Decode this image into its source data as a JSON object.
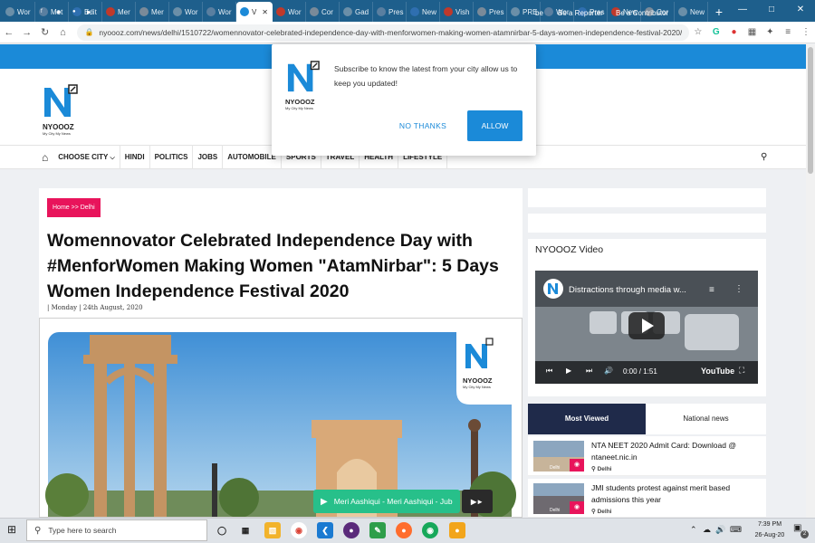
{
  "browser": {
    "tabs": [
      {
        "label": "Wor"
      },
      {
        "label": "Met"
      },
      {
        "label": "Edit"
      },
      {
        "label": "Mer"
      },
      {
        "label": "Mer"
      },
      {
        "label": "Wor"
      },
      {
        "label": "Wor"
      },
      {
        "label": "V",
        "active": true
      },
      {
        "label": "Wor"
      },
      {
        "label": "Cor"
      },
      {
        "label": "Gad"
      },
      {
        "label": "Pres"
      },
      {
        "label": "New"
      },
      {
        "label": "Vish"
      },
      {
        "label": "Pres"
      },
      {
        "label": "PRE"
      },
      {
        "label": "Wor"
      },
      {
        "label": "Pres"
      },
      {
        "label": "New"
      },
      {
        "label": "Cor"
      },
      {
        "label": "New"
      }
    ],
    "url": "nyoooz.com/news/delhi/1510722/womennovator-celebrated-independence-day-with-menforwomen-making-women-atamnirbar-5-days-women-independence-festival-2020/"
  },
  "site": {
    "top_links": [
      "Be a Reporter",
      "Be a Contributor"
    ],
    "top_link_partial": "be",
    "logo_text": "NYOOOZ",
    "logo_tagline": "My City My News",
    "nav": [
      "Choose City",
      "Hindi",
      "Politics",
      "Jobs",
      "Automobile",
      "Sports",
      "Travel",
      "Health",
      "Lifestyle"
    ]
  },
  "article": {
    "breadcrumb": "Home >> Delhi",
    "title": "Womennovator Celebrated Independence Day with #MenforWomen Making Women \"AtamNirbar\": 5 Days Women Independence Festival 2020",
    "date": "| Monday | 24th August, 2020"
  },
  "music": {
    "label": "Meri Aashiqui - Meri Aashiqui - Jub"
  },
  "sidebar": {
    "video_title": "NYOOOZ Video",
    "video_caption": "Distractions through media w...",
    "video_time": "0:00 / 1:51",
    "video_brand": "YouTube",
    "tabs": [
      "Most Viewed",
      "National news"
    ],
    "news": [
      {
        "title": "NTA NEET 2020 Admit Card: Download @ ntaneet.nic.in",
        "location": "Delhi",
        "tag": "Delhi"
      },
      {
        "title": "JMI students protest against merit based admissions this year",
        "location": "Delhi",
        "tag": "Delhi"
      }
    ]
  },
  "popup": {
    "message": "Subscribe to know the latest from your city allow us to keep you updated!",
    "no_thanks": "NO THANKS",
    "allow": "ALLOW"
  },
  "taskbar": {
    "search_placeholder": "Type here to search",
    "time": "7:39 PM",
    "date": "26-Aug-20",
    "notifications": "2"
  },
  "colors": {
    "brand_blue": "#1b8ad8",
    "accent_pink": "#e8145b",
    "navy": "#1f2a4a",
    "music_green": "#27c08a"
  }
}
